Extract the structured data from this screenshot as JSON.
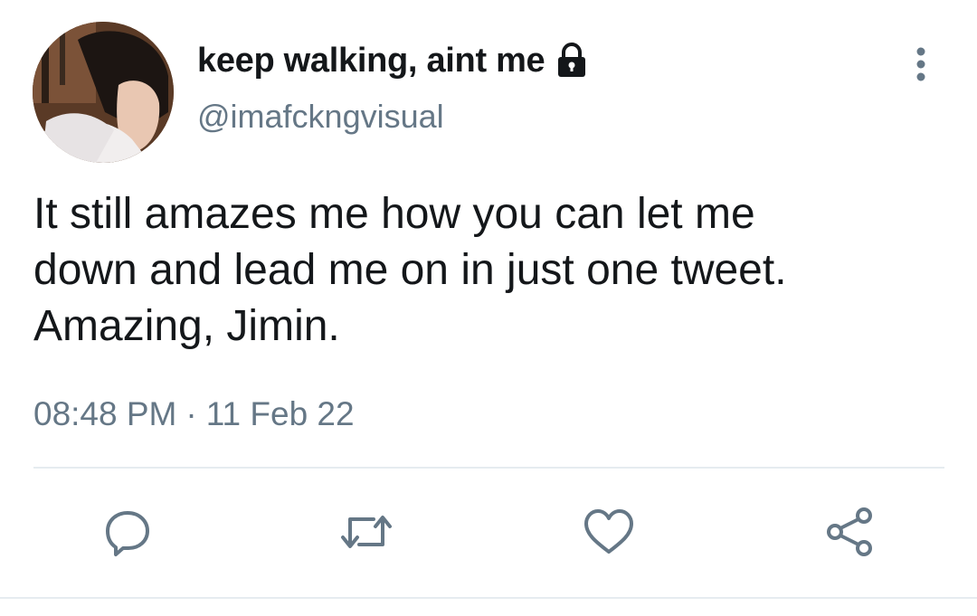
{
  "tweet": {
    "display_name": "keep walking, aint me",
    "handle": "@imafckngvisual",
    "text_lines": [
      "It still amazes me how you can let me",
      "down and lead me on in just one tweet.",
      "Amazing, Jimin."
    ],
    "time": "08:48 PM",
    "separator": "·",
    "date": "11 Feb 22"
  },
  "icons": {
    "lock": "lock-icon",
    "more": "more-vertical-icon",
    "reply": "reply-icon",
    "retweet": "retweet-icon",
    "like": "heart-icon",
    "share": "share-icon"
  },
  "colors": {
    "text": "#14171a",
    "secondary": "#657786",
    "icon": "#657786",
    "divider": "#e6ecf0"
  }
}
